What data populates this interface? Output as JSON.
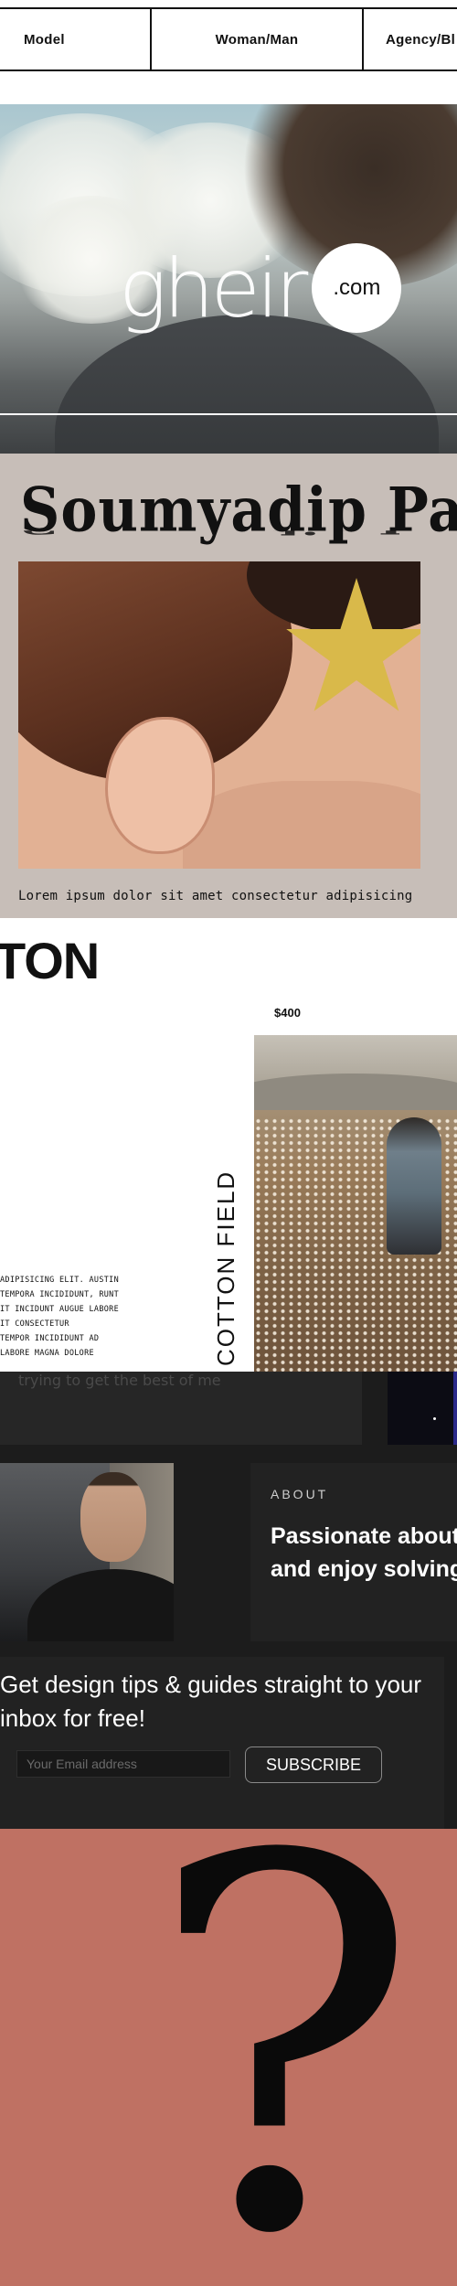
{
  "nav": {
    "tabs": [
      "Model",
      "Woman/Man",
      "Agency/Bl"
    ]
  },
  "hero": {
    "logo_word": "gheir",
    "logo_suffix": ".com"
  },
  "portfolio_card": {
    "title": "Soumyadip Pal",
    "caption": "Lorem ipsum dolor sit amet consectetur adipisicing"
  },
  "cotton": {
    "heading": "TON",
    "price": "$400",
    "vertical_title": "COTTON FIELD",
    "body_lines": [
      "ADIPISICING ELIT. AUSTIN",
      "TEMPORA INCIDIDUNT, RUNT",
      "IT INCIDUNT AUGUE LABORE",
      "IT CONSECTETUR",
      "TEMPOR INCIDIDUNT AD",
      "LABORE MAGNA DOLORE"
    ]
  },
  "dark_site": {
    "top_text": "trying to get the best of me",
    "about_label": "ABOUT",
    "about_text": "Passionate about design and enjoy solving",
    "newsletter_title": "Get design tips & guides straight to your inbox for free!",
    "email_placeholder": "Your Email address",
    "subscribe_label": "SUBSCRIBE"
  },
  "question_block": {
    "glyph": "?",
    "background": "#bf7163"
  },
  "colors": {
    "dark_bg": "#1c1c1c",
    "card_bg": "#c7beb8",
    "star": "#d9b94a"
  }
}
